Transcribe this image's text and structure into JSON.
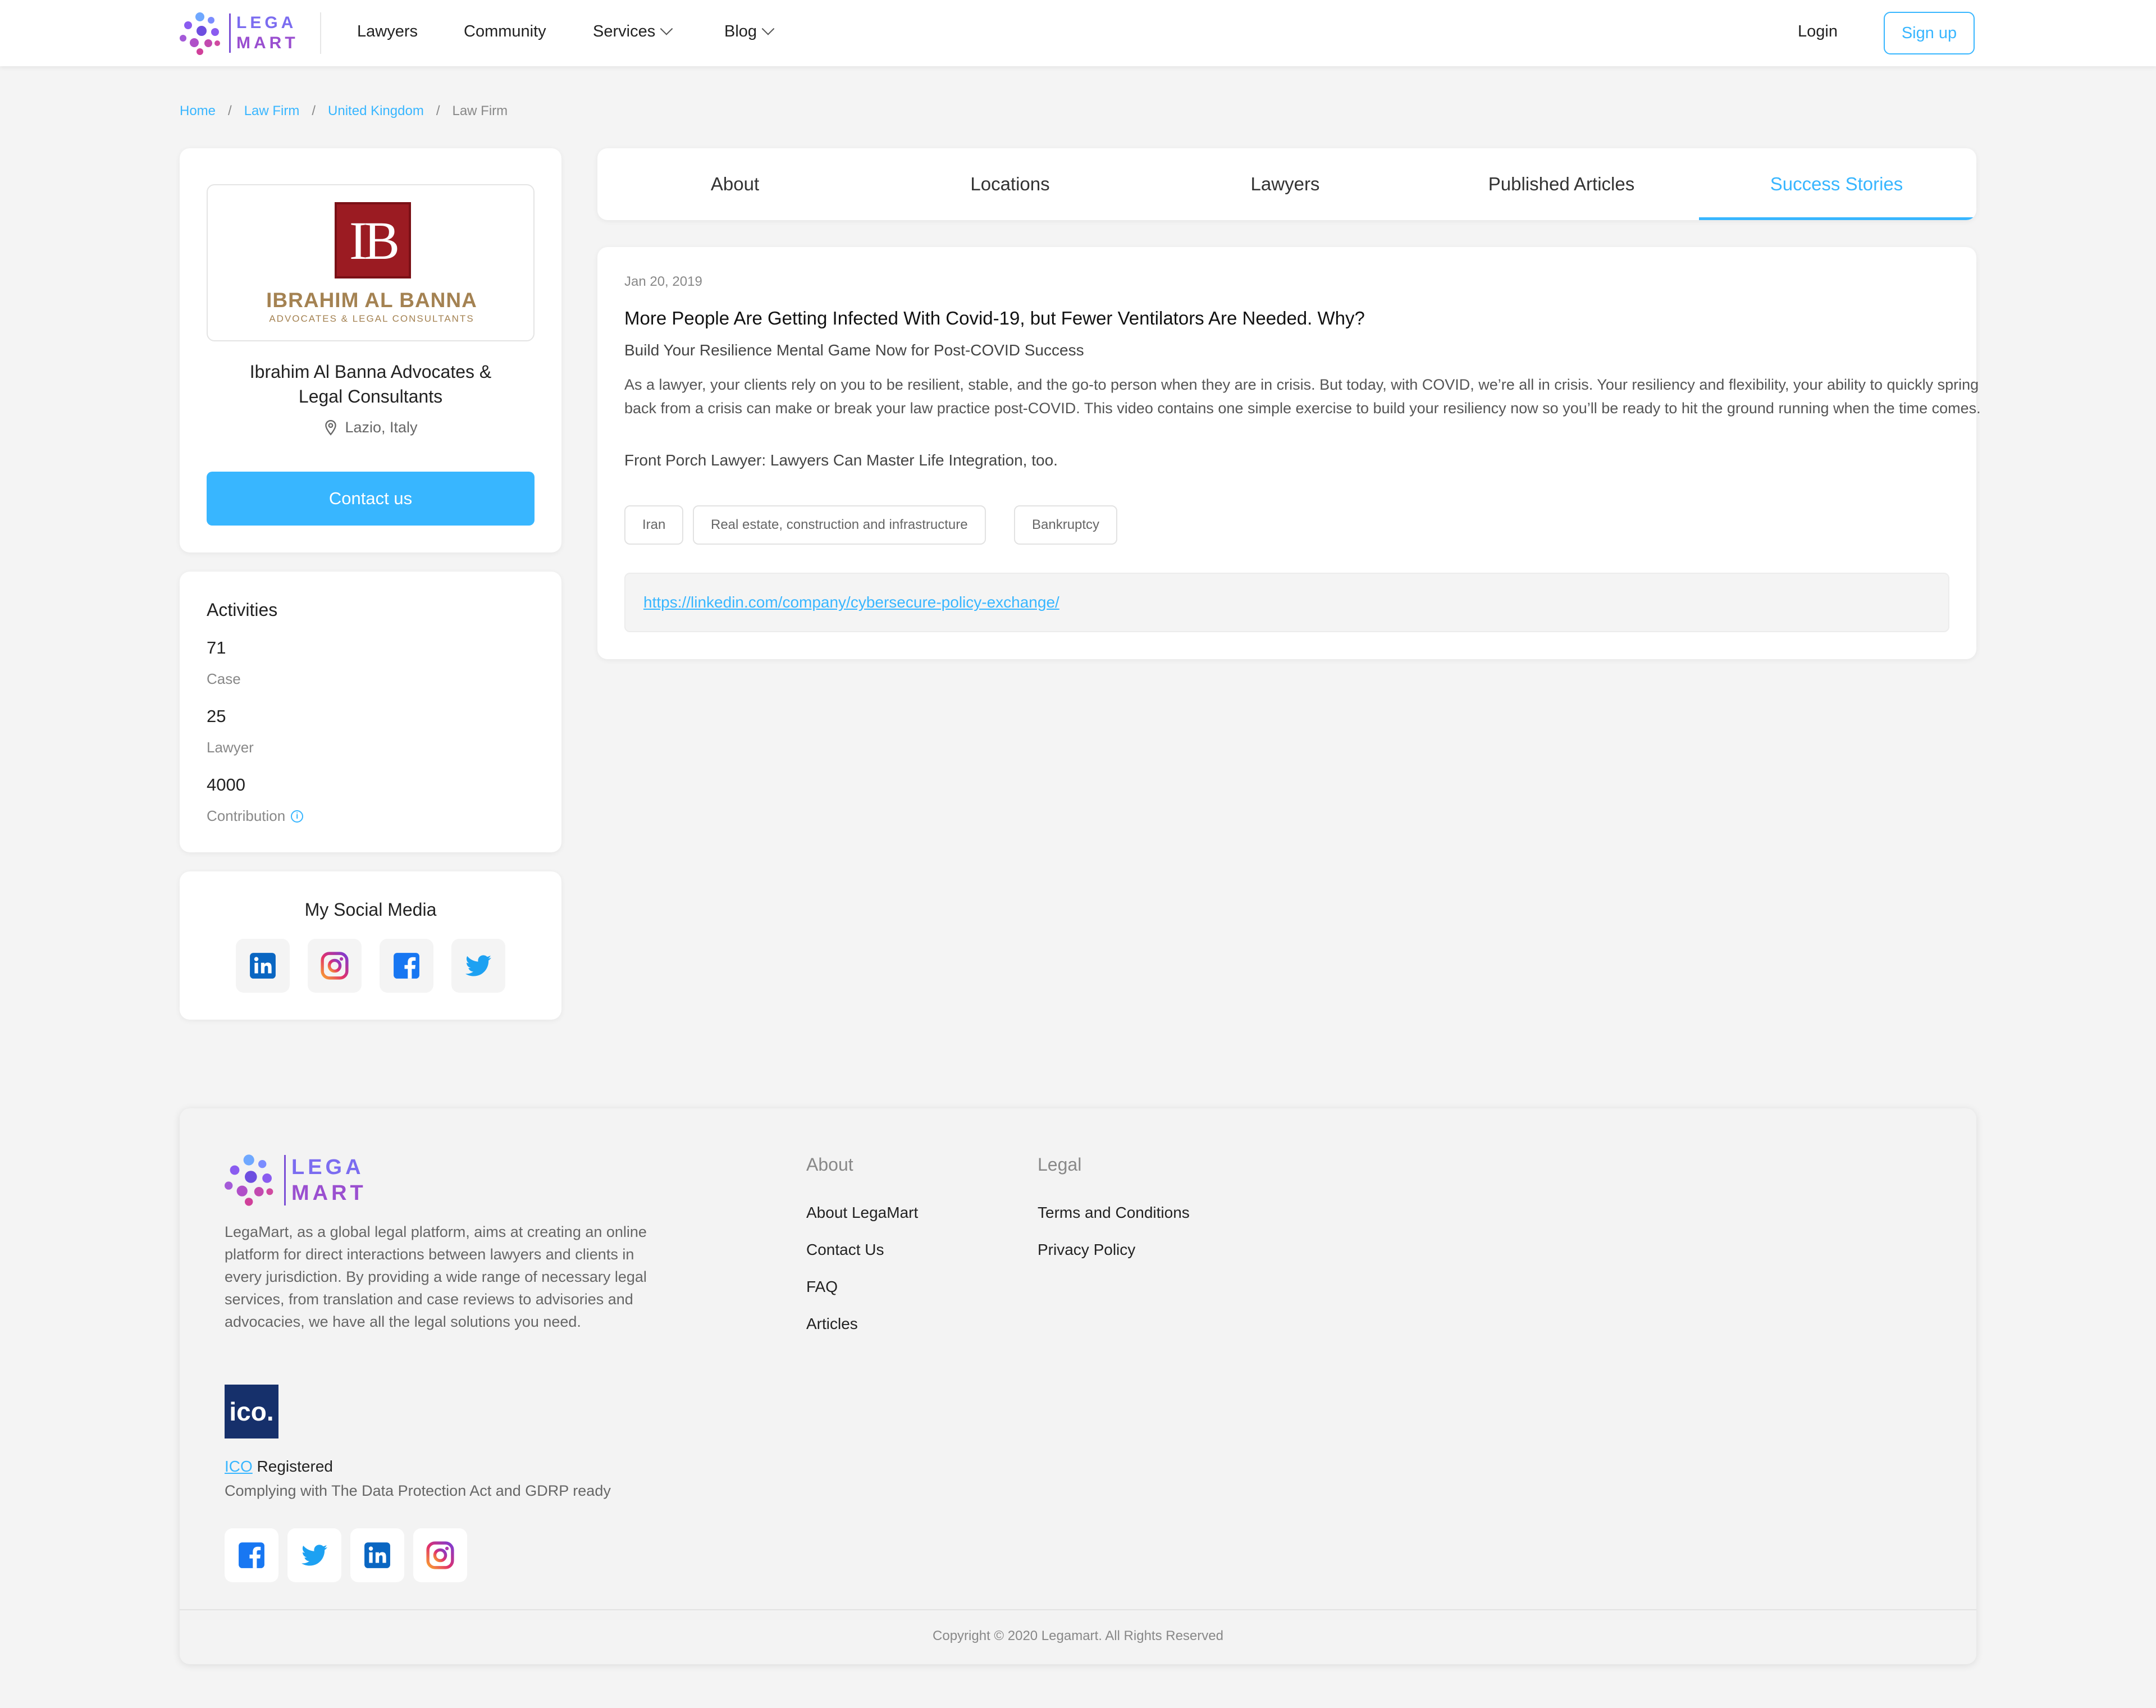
{
  "brand": {
    "logo_line1": "LEGA",
    "logo_line2": "MART"
  },
  "nav": {
    "lawyers": "Lawyers",
    "community": "Community",
    "services": "Services",
    "blog": "Blog",
    "login": "Login",
    "signup": "Sign up"
  },
  "breadcrumb": {
    "home": "Home",
    "law_firm": "Law Firm",
    "country": "United Kingdom",
    "current": "Law Firm",
    "sep": "/"
  },
  "firm": {
    "logo_initials": "IB",
    "logo_name": "IBRAHIM AL BANNA",
    "logo_sub": "ADVOCATES & LEGAL CONSULTANTS",
    "name": "Ibrahim Al Banna Advocates & Legal Consultants",
    "location": "Lazio, Italy",
    "contact": "Contact us"
  },
  "activities": {
    "title": "Activities",
    "items": [
      {
        "value": "71",
        "label": "Case"
      },
      {
        "value": "25",
        "label": "Lawyer"
      },
      {
        "value": "4000",
        "label": "Contribution"
      }
    ],
    "info": "i"
  },
  "social": {
    "title": "My Social Media"
  },
  "tabs": [
    {
      "label": "About"
    },
    {
      "label": "Locations"
    },
    {
      "label": "Lawyers"
    },
    {
      "label": "Published Articles"
    },
    {
      "label": "Success Stories"
    }
  ],
  "story": {
    "date": "Jan 20, 2019",
    "title": "More People Are Getting Infected With Covid-19, but Fewer Ventilators Are Needed. Why?",
    "subtitle": "Build Your Resilience Mental Game Now for Post-COVID Success",
    "body": "As a lawyer, your clients rely on you to be resilient, stable, and the go-to person when they are in crisis. But today, with COVID, we’re all in crisis. Your resiliency and flexibility, your ability to quickly spring back from a crisis can make or break your law practice post-COVID. This video contains one simple exercise to build your resiliency now so you’ll be ready to hit the ground running when the time comes.",
    "extra": "Front Porch Lawyer: Lawyers Can Master Life Integration, too.",
    "tags": [
      "Iran",
      "Real estate, construction and infrastructure",
      "Bankruptcy"
    ],
    "link": "https://linkedin.com/company/cybersecure-policy-exchange/"
  },
  "footer": {
    "description": "LegaMart, as a global legal platform, aims at creating an online platform for direct interactions between lawyers and clients in every jurisdiction. By providing a wide range of necessary legal services, from translation and case reviews to advisories and advocacies, we have all the legal solutions you need.",
    "ico_badge": "ico.",
    "ico_link": "ICO",
    "ico_registered": " Registered",
    "ico_comply": "Complying with The Data Protection Act and GDRP ready",
    "about_title": "About",
    "about_links": [
      "About LegaMart",
      "Contact Us",
      "FAQ",
      "Articles"
    ],
    "legal_title": "Legal",
    "legal_links": [
      "Terms and Conditions",
      "Privacy Policy"
    ],
    "copyright": "Copyright © 2020 Legamart. All Rights Reserved"
  },
  "colors": {
    "accent": "#38b6ff",
    "brand_purple": "#7b4fd6",
    "firm_red": "#9b1b22",
    "firm_gold": "#a48252",
    "ico_navy": "#16306b"
  },
  "icons": [
    "legamart-logo",
    "chevron-down-icon",
    "location-pin-icon",
    "info-icon",
    "linkedin-icon",
    "instagram-icon",
    "facebook-icon",
    "twitter-icon"
  ]
}
